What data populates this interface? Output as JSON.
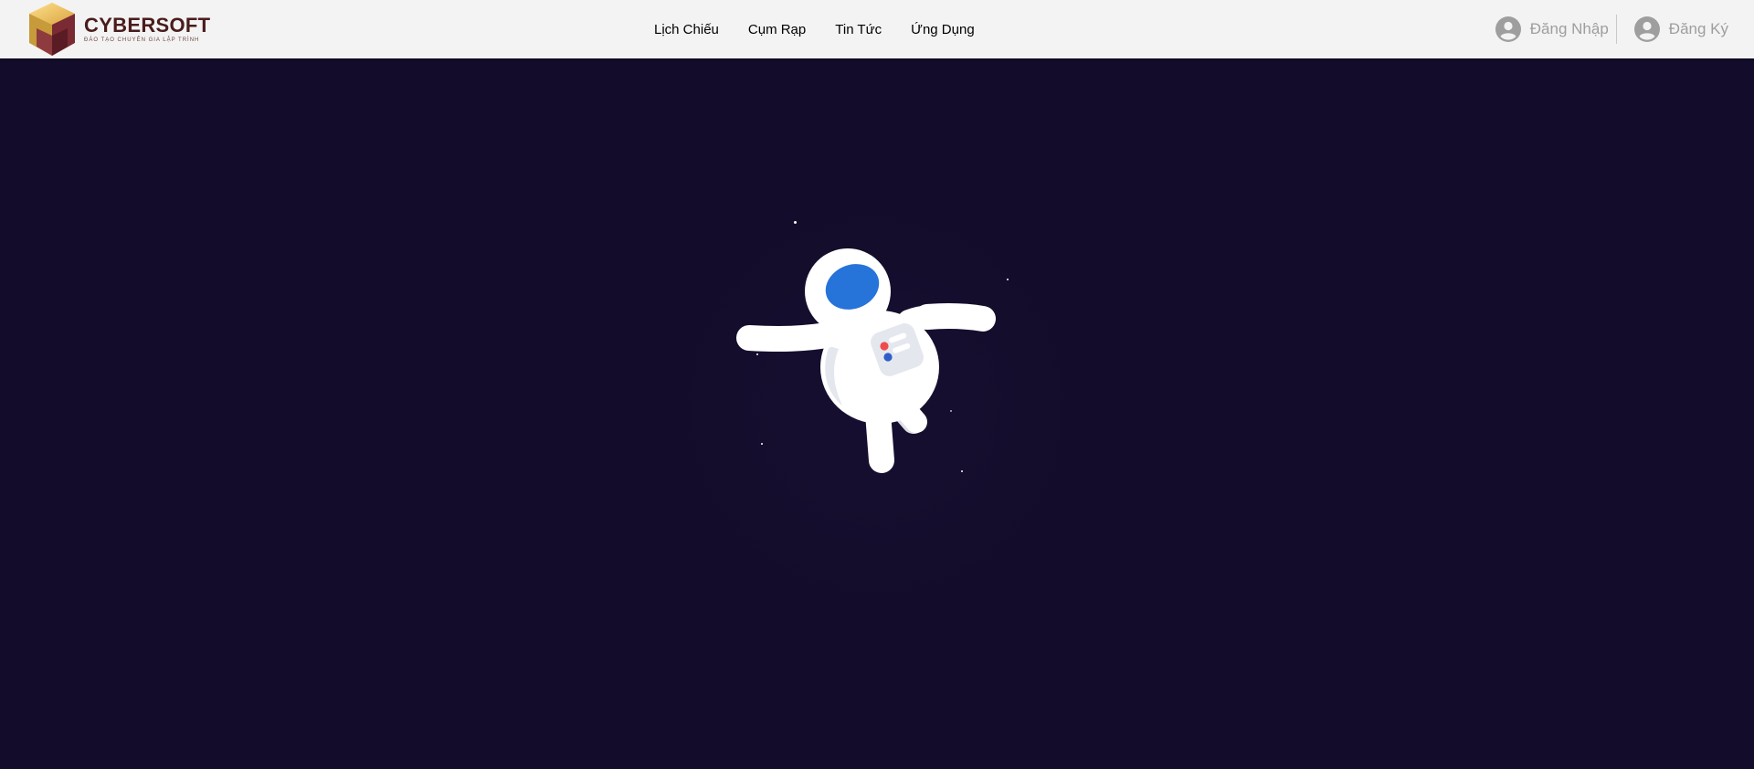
{
  "header": {
    "logo": {
      "name": "CYBERSOFT",
      "tagline": "ĐÀO TẠO CHUYÊN GIA LẬP TRÌNH"
    },
    "nav": [
      {
        "label": "Lịch Chiếu"
      },
      {
        "label": "Cụm Rạp"
      },
      {
        "label": "Tin Tức"
      },
      {
        "label": "Ứng Dụng"
      }
    ],
    "auth": {
      "login_label": "Đăng Nhập",
      "login_icon": "user-circle-icon",
      "register_label": "Đăng Ký",
      "register_icon": "user-circle-icon"
    }
  },
  "colors": {
    "header_bg": "#f3f3f3",
    "page_bg": "#130c2a",
    "visor": "#2673d9",
    "auth_text": "#9e9e9e",
    "brand_text": "#4a1c1c"
  },
  "illustration": {
    "icon": "floating-astronaut-illustration"
  }
}
